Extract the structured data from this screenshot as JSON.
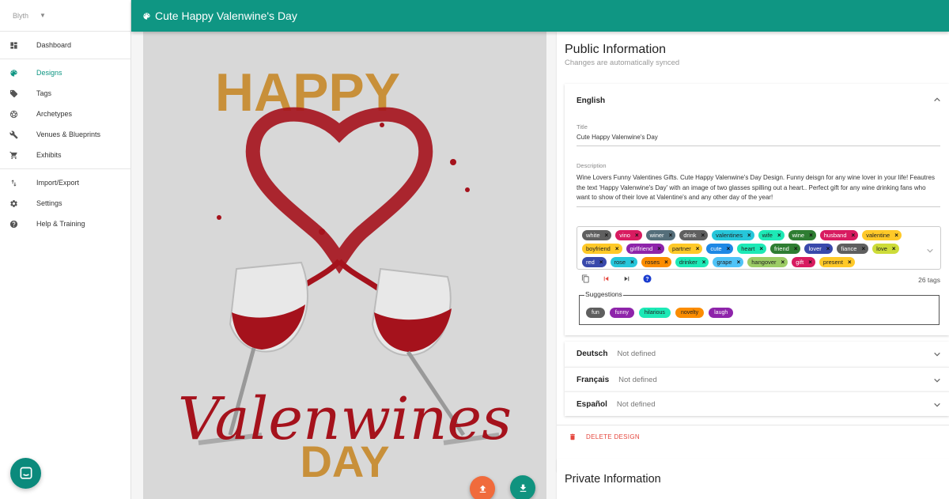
{
  "sidebar": {
    "account": "Blyth",
    "groups": [
      [
        {
          "label": "Dashboard",
          "icon": "dashboard-icon"
        }
      ],
      [
        {
          "label": "Designs",
          "icon": "palette-icon",
          "active": true
        },
        {
          "label": "Tags",
          "icon": "tag-icon"
        },
        {
          "label": "Archetypes",
          "icon": "football-icon"
        },
        {
          "label": "Venues & Blueprints",
          "icon": "wrench-icon"
        },
        {
          "label": "Exhibits",
          "icon": "cart-icon"
        }
      ],
      [
        {
          "label": "Import/Export",
          "icon": "import-export-icon"
        },
        {
          "label": "Settings",
          "icon": "gear-icon"
        },
        {
          "label": "Help & Training",
          "icon": "help-icon"
        }
      ]
    ]
  },
  "header": {
    "title": "Cute Happy Valenwine's Day"
  },
  "design": {
    "image_text_top": "HAPPY",
    "image_text_script": "Valenwines",
    "image_text_bottom": "DAY"
  },
  "public": {
    "title": "Public Information",
    "subtitle": "Changes are automatically synced",
    "english": {
      "label": "English",
      "title_label": "Title",
      "title_value": "Cute Happy Valenwine's Day",
      "description_label": "Description",
      "description_value": "Wine Lovers Funny Valentines Gifts. Cute Happy Valenwine's Day Design. Funny deisgn for any wine lover in your life! Feautres the text 'Happy Valenwine's Day' with an image of two glasses spilling out a heart.. Perfect gift for any wine drinking fans who want to show of their love at Valentine's and any other day of the year!",
      "tags": [
        {
          "label": "white",
          "bg": "#5f5f5f",
          "fg": "#ffffff"
        },
        {
          "label": "vino",
          "bg": "#d81b60",
          "fg": "#ffffff"
        },
        {
          "label": "winer",
          "bg": "#546e7a",
          "fg": "#ffffff"
        },
        {
          "label": "drink",
          "bg": "#5f5f5f",
          "fg": "#ffffff"
        },
        {
          "label": "valentines",
          "bg": "#26c6da",
          "fg": "#222222"
        },
        {
          "label": "wife",
          "bg": "#1de9b6",
          "fg": "#222222"
        },
        {
          "label": "wine",
          "bg": "#2e7d32",
          "fg": "#ffffff"
        },
        {
          "label": "husband",
          "bg": "#d81b60",
          "fg": "#ffffff"
        },
        {
          "label": "valentine",
          "bg": "#ffc928",
          "fg": "#222222"
        },
        {
          "label": "boyfriend",
          "bg": "#ffc928",
          "fg": "#222222"
        },
        {
          "label": "girlfriend",
          "bg": "#8e24aa",
          "fg": "#ffffff"
        },
        {
          "label": "partner",
          "bg": "#ffc928",
          "fg": "#222222"
        },
        {
          "label": "cute",
          "bg": "#1e88e5",
          "fg": "#ffffff"
        },
        {
          "label": "heart",
          "bg": "#1de9b6",
          "fg": "#222222"
        },
        {
          "label": "friend",
          "bg": "#2e7d32",
          "fg": "#ffffff"
        },
        {
          "label": "lover",
          "bg": "#3949ab",
          "fg": "#ffffff"
        },
        {
          "label": "fiance",
          "bg": "#5f5f5f",
          "fg": "#ffffff"
        },
        {
          "label": "love",
          "bg": "#cddc39",
          "fg": "#222222"
        },
        {
          "label": "red",
          "bg": "#3949ab",
          "fg": "#ffffff"
        },
        {
          "label": "rose",
          "bg": "#26c6da",
          "fg": "#222222"
        },
        {
          "label": "roses",
          "bg": "#fb8c00",
          "fg": "#222222"
        },
        {
          "label": "drinker",
          "bg": "#1de9b6",
          "fg": "#222222"
        },
        {
          "label": "grape",
          "bg": "#4fc3f7",
          "fg": "#222222"
        },
        {
          "label": "hangover",
          "bg": "#9ccc65",
          "fg": "#222222"
        },
        {
          "label": "gift",
          "bg": "#d81b60",
          "fg": "#ffffff"
        },
        {
          "label": "present",
          "bg": "#ffc928",
          "fg": "#222222"
        }
      ],
      "tag_count": "26 tags",
      "suggestions_label": "Suggestions",
      "suggestions": [
        {
          "label": "fun",
          "bg": "#5f5f5f",
          "fg": "#ffffff"
        },
        {
          "label": "funny",
          "bg": "#8e24aa",
          "fg": "#ffffff"
        },
        {
          "label": "hilarious",
          "bg": "#1de9b6",
          "fg": "#222222"
        },
        {
          "label": "novelty",
          "bg": "#fb8c00",
          "fg": "#222222"
        },
        {
          "label": "laugh",
          "bg": "#8e24aa",
          "fg": "#ffffff"
        }
      ]
    },
    "other_languages": [
      {
        "label": "Deutsch",
        "status": "Not defined"
      },
      {
        "label": "Français",
        "status": "Not defined"
      },
      {
        "label": "Español",
        "status": "Not defined"
      }
    ],
    "delete_label": "DELETE DESIGN"
  },
  "private": {
    "title": "Private Information"
  },
  "colors": {
    "primary": "#0f9683",
    "danger": "#e5483f",
    "upload_fab": "#f06b3c",
    "wine": "#a5121c",
    "gold": "#c8903a"
  }
}
